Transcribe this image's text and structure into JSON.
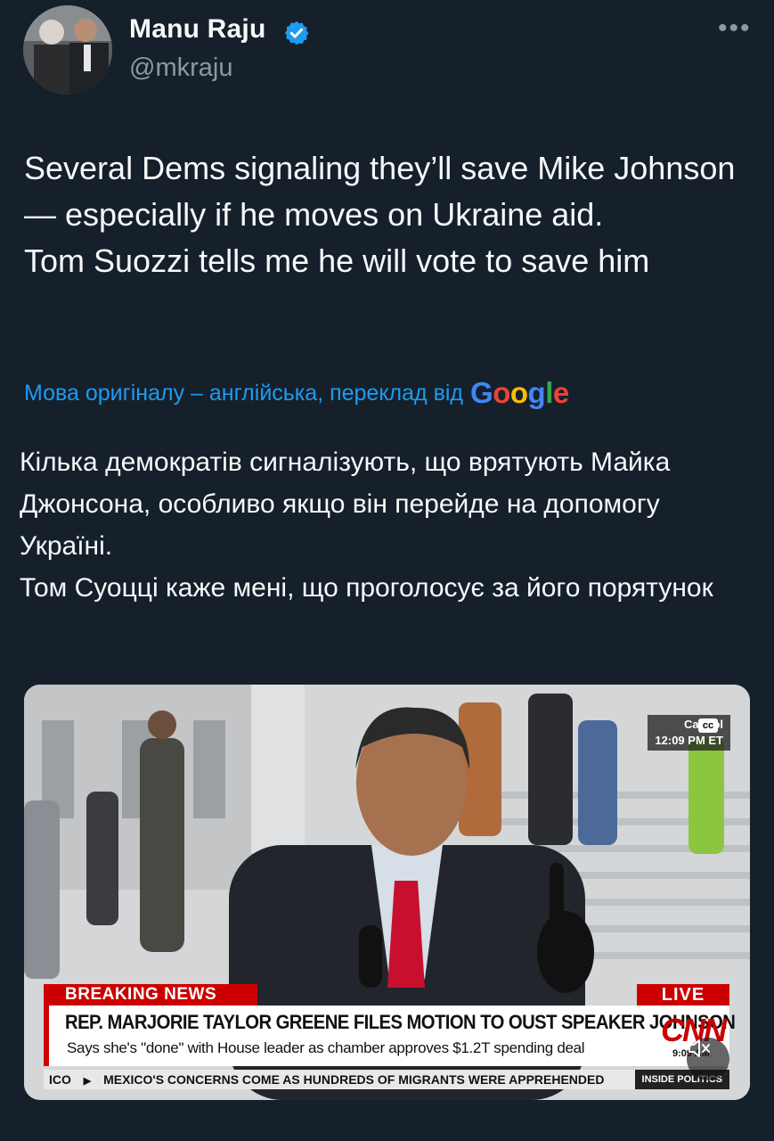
{
  "author": {
    "name": "Manu Raju",
    "handle": "@mkraju",
    "verified_icon": "verified-badge-icon",
    "more_label": "•••"
  },
  "tweet": {
    "lines": [
      "Several Dems signaling they’ll save Mike Johnson — especially if he moves on Ukraine aid.",
      "Tom Suozzi tells me he will vote to save him"
    ]
  },
  "translation": {
    "notice": "Мова оригіналу – англійська, переклад від",
    "provider": "Google",
    "lines": [
      "Кілька демократів сигналізують, що врятують Майка Джонсона, особливо якщо він перейде на допомогу Україні.",
      "Том Суоцці каже мені, що проголосує за його порятунок"
    ]
  },
  "media": {
    "location_bug": "Capitol",
    "time_bug": "12:09 PM ET",
    "cc_label": "cc",
    "breaking_label": "BREAKING NEWS",
    "live_label": "LIVE",
    "headline": "REP. MARJORIE TAYLOR GREENE FILES MOTION TO OUST SPEAKER JOHNSON",
    "subhead": "Says she's \"done\" with House leader as chamber approves $1.2T spending deal",
    "network": "CNN",
    "clock": "9:09 AM",
    "ticker_prefix": "ICO",
    "ticker_text": "MEXICO'S CONCERNS COME AS HUNDREDS OF MIGRANTS WERE APPREHENDED",
    "show_name": "INSIDE POLITICS"
  },
  "colors": {
    "background": "#15202b",
    "link": "#1d9bf0",
    "secondary_text": "#8b98a5",
    "cnn_red": "#cc0000"
  }
}
